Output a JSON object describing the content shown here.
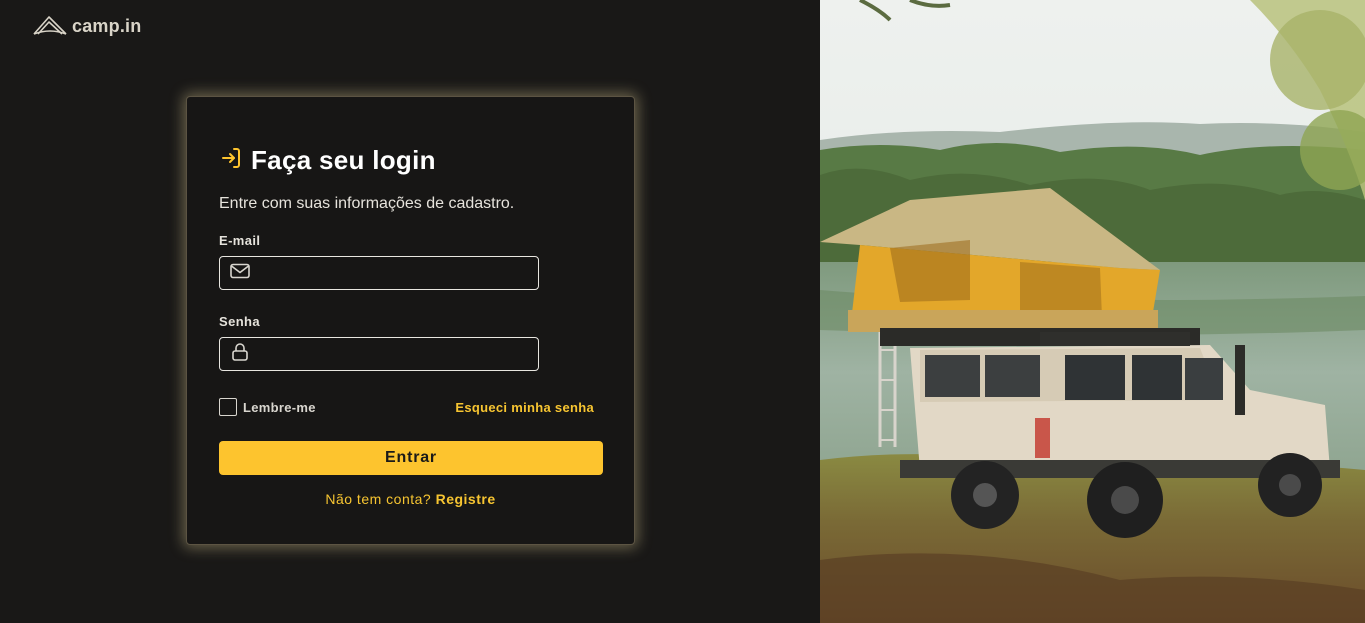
{
  "brand": {
    "name": "camp.in"
  },
  "login": {
    "title": "Faça seu login",
    "subtitle": "Entre com suas informações de cadastro.",
    "email_label": "E-mail",
    "email_value": "",
    "password_label": "Senha",
    "password_value": "",
    "remember_label": "Lembre-me",
    "remember_checked": false,
    "forgot_label": "Esqueci minha senha",
    "submit_label": "Entrar",
    "signup_question": "Não tem conta?",
    "signup_link": "Registre"
  },
  "icons": {
    "logo": "tent-logo-icon",
    "title": "login-arrow-icon",
    "email": "mail-icon",
    "password": "lock-icon"
  },
  "colors": {
    "background": "#191817",
    "accent": "#fdc42e",
    "card_glow": "#fff0b0",
    "text": "#e6e3dc"
  }
}
